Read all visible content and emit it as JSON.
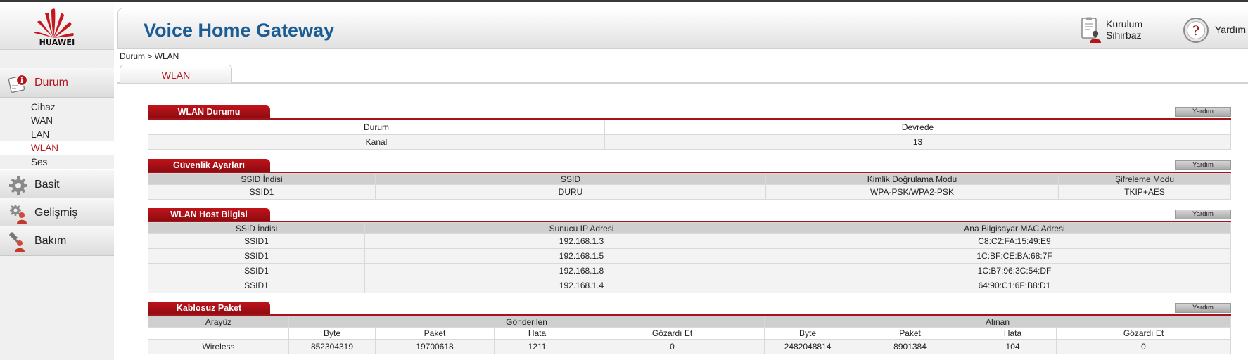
{
  "brand": {
    "name": "HUAWEI",
    "color": "#c8161d"
  },
  "header": {
    "title": "Voice Home Gateway",
    "wizard_label_1": "Kurulum",
    "wizard_label_2": "Sihirbaz",
    "help_label": "Yardım"
  },
  "breadcrumb": "Durum > WLAN",
  "tab": {
    "label": "WLAN"
  },
  "menu": {
    "status": {
      "label": "Durum",
      "icon": "status-info-icon"
    },
    "status_items": [
      "Cihaz",
      "WAN",
      "LAN",
      "WLAN",
      "Ses"
    ],
    "basic": {
      "label": "Basit",
      "icon": "gear-icon"
    },
    "advanced": {
      "label": "Gelişmiş",
      "icon": "advanced-gear-user-icon"
    },
    "maintenance": {
      "label": "Bakım",
      "icon": "wrench-user-icon"
    }
  },
  "colors": {
    "accent": "#b3161b",
    "title_blue": "#1a5c93",
    "section_red": "#a4141a"
  },
  "wlan_status": {
    "title": "WLAN Durumu",
    "help": "Yardım",
    "headers": [
      "Durum",
      "Devrede"
    ],
    "row": [
      "Kanal",
      "13"
    ]
  },
  "security": {
    "title": "Güvenlik Ayarları",
    "help": "Yardım",
    "headers": [
      "SSID İndisi",
      "SSID",
      "Kimlik Doğrulama Modu",
      "Şifreleme Modu"
    ],
    "row": [
      "SSID1",
      "DURU",
      "WPA-PSK/WPA2-PSK",
      "TKIP+AES"
    ]
  },
  "hosts": {
    "title": "WLAN Host Bilgisi",
    "help": "Yardım",
    "headers": [
      "SSID İndisi",
      "Sunucu IP Adresi",
      "Ana Bilgisayar MAC Adresi"
    ],
    "rows": [
      [
        "SSID1",
        "192.168.1.3",
        "C8:C2:FA:15:49:E9"
      ],
      [
        "SSID1",
        "192.168.1.5",
        "1C:BF:CE:BA:68:7F"
      ],
      [
        "SSID1",
        "192.168.1.8",
        "1C:B7:96:3C:54:DF"
      ],
      [
        "SSID1",
        "192.168.1.4",
        "64:90:C1:6F:B8:D1"
      ]
    ]
  },
  "packets": {
    "title": "Kablosuz Paket",
    "help": "Yardım",
    "col_interface": "Arayüz",
    "col_sent": "Gönderilen",
    "col_received": "Alınan",
    "sub_headers": [
      "Byte",
      "Paket",
      "Hata",
      "Gözardı Et",
      "Byte",
      "Paket",
      "Hata",
      "Gözardı Et"
    ],
    "row": [
      "Wireless",
      "852304319",
      "19700618",
      "1211",
      "0",
      "2482048814",
      "8901384",
      "104",
      "0"
    ]
  }
}
